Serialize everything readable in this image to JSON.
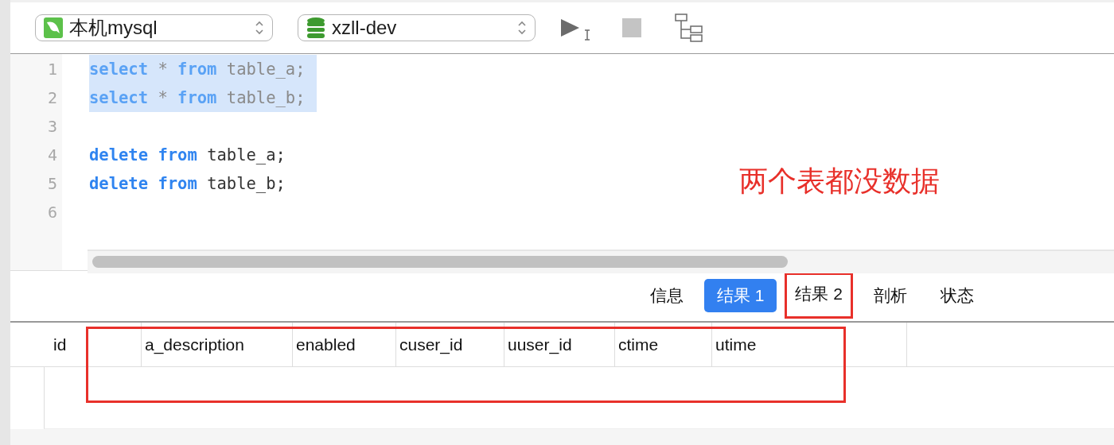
{
  "toolbar": {
    "connection": "本机mysql",
    "database": "xzll-dev"
  },
  "editor": {
    "lines": [
      {
        "number": "1",
        "selected": true,
        "tokens": [
          {
            "kind": "keyword",
            "text": "select"
          },
          {
            "kind": "plain",
            "text": "*"
          },
          {
            "kind": "keyword",
            "text": "from"
          },
          {
            "kind": "plain",
            "text": "table_a;"
          }
        ]
      },
      {
        "number": "2",
        "selected": true,
        "tokens": [
          {
            "kind": "keyword",
            "text": "select"
          },
          {
            "kind": "plain",
            "text": "*"
          },
          {
            "kind": "keyword",
            "text": "from"
          },
          {
            "kind": "plain",
            "text": "table_b;"
          }
        ]
      },
      {
        "number": "3"
      },
      {
        "number": "4",
        "selected": false,
        "tokens": [
          {
            "kind": "keyword",
            "text": "delete"
          },
          {
            "kind": "keyword",
            "text": "from"
          },
          {
            "kind": "plain",
            "text": "table_a;"
          }
        ]
      },
      {
        "number": "5",
        "selected": false,
        "tokens": [
          {
            "kind": "keyword",
            "text": "delete"
          },
          {
            "kind": "keyword",
            "text": "from"
          },
          {
            "kind": "plain",
            "text": "table_b;"
          }
        ]
      },
      {
        "number": "6"
      }
    ],
    "annotation": "两个表都没数据"
  },
  "result_tabs": [
    {
      "label": "信息",
      "selected": false,
      "outlined": false
    },
    {
      "label": "结果 1",
      "selected": true,
      "outlined": false
    },
    {
      "label": "结果 2",
      "selected": false,
      "outlined": true
    },
    {
      "label": "剖析",
      "selected": false,
      "outlined": false
    },
    {
      "label": "状态",
      "selected": false,
      "outlined": false
    }
  ],
  "table": {
    "outlined": true,
    "columns": [
      "id",
      "a_description",
      "enabled",
      "cuser_id",
      "uuser_id",
      "ctime",
      "utime"
    ]
  }
}
